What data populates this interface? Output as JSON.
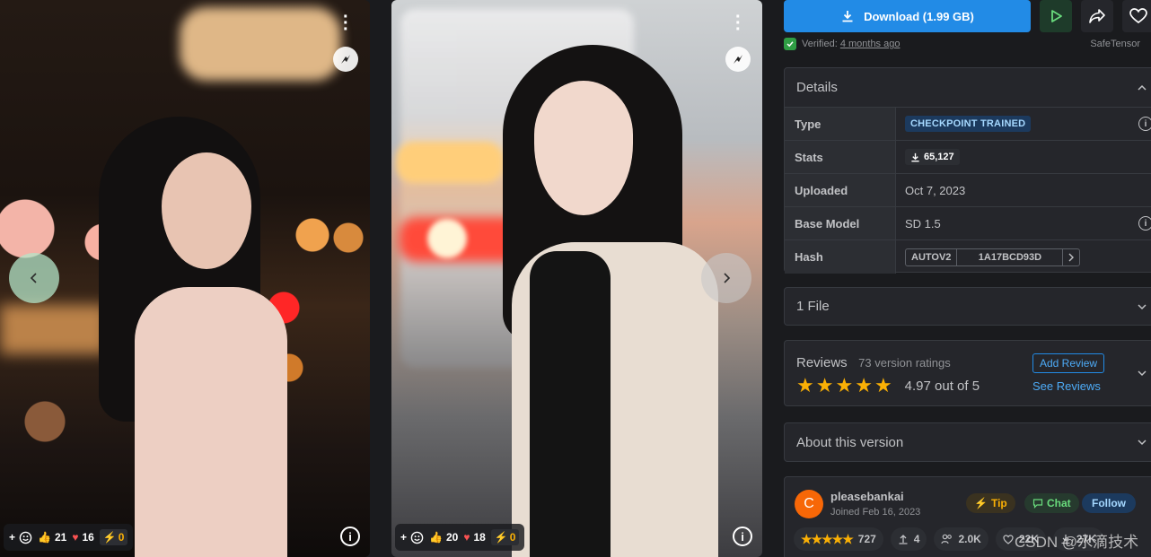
{
  "gallery": {
    "cards": [
      {
        "likes": "21",
        "hearts": "16",
        "buzz": "0"
      },
      {
        "likes": "20",
        "hearts": "18",
        "buzz": "0"
      }
    ]
  },
  "actions": {
    "download_label": "Download (1.99 GB)"
  },
  "verification": {
    "label": "Verified:",
    "when": "4 months ago",
    "format": "SafeTensor"
  },
  "details": {
    "title": "Details",
    "rows": {
      "type": {
        "label": "Type",
        "value": "CHECKPOINT TRAINED"
      },
      "stats": {
        "label": "Stats",
        "value": "65,127"
      },
      "uploaded": {
        "label": "Uploaded",
        "value": "Oct 7, 2023"
      },
      "base_model": {
        "label": "Base Model",
        "value": "SD 1.5"
      },
      "hash": {
        "label": "Hash",
        "algorithm": "AUTOV2",
        "value": "1A17BCD93D"
      }
    }
  },
  "files": {
    "title": "1 File"
  },
  "reviews": {
    "title": "Reviews",
    "count": "73 version ratings",
    "stars": 5,
    "score": "4.97 out of 5",
    "add_label": "Add Review",
    "see_label": "See Reviews"
  },
  "about": {
    "title": "About this version"
  },
  "creator": {
    "initial": "C",
    "name": "pleasebankai",
    "joined": "Joined Feb 16, 2023",
    "tip_label": "Tip",
    "chat_label": "Chat",
    "follow_label": "Follow",
    "rating_count": "727",
    "uploads": "4",
    "followers": "2.0K",
    "favorites": "22K",
    "downloads": "27K"
  },
  "watermark": "CSDN @水滴技术",
  "colors": {
    "accent": "#228be6",
    "star": "#fab005",
    "avatar": "#f76707"
  }
}
